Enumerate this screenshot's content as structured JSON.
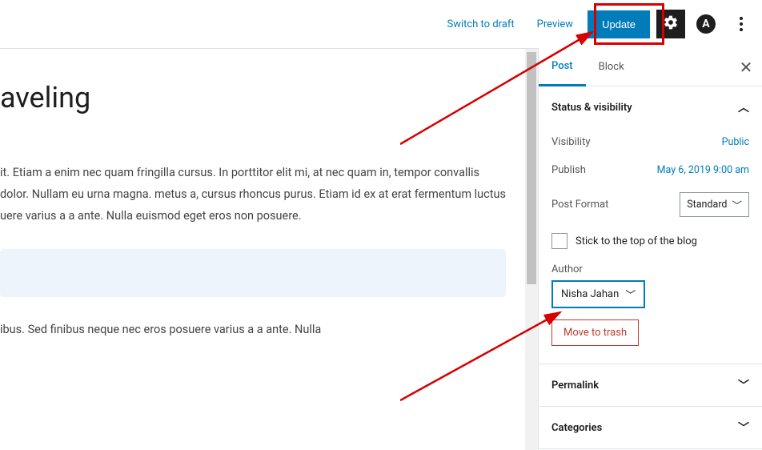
{
  "topbar": {
    "switch_draft": "Switch to draft",
    "preview": "Preview",
    "update": "Update"
  },
  "icons": {
    "settings": "gear",
    "brand_letter": "A"
  },
  "editor": {
    "title": "aveling",
    "para1": "it. Etiam a enim nec quam fringilla cursus. In porttitor elit mi, at nec quam in, tempor convallis dolor. Nullam eu urna magna. metus a, cursus rhoncus purus.  Etiam id ex at erat fermentum luctus uere varius a a ante. Nulla euismod eget eros non posuere.",
    "para2": "ibus. Sed finibus neque nec eros posuere varius a a ante. Nulla"
  },
  "sidebar": {
    "tabs": {
      "post": "Post",
      "block": "Block"
    },
    "panels": {
      "status": {
        "title": "Status & visibility",
        "visibility_label": "Visibility",
        "visibility_value": "Public",
        "publish_label": "Publish",
        "publish_value": "May 6, 2019 9:00 am",
        "format_label": "Post Format",
        "format_value": "Standard",
        "stick_label": "Stick to the top of the blog",
        "author_label": "Author",
        "author_value": "Nisha Jahan",
        "trash": "Move to trash"
      },
      "permalink": {
        "title": "Permalink"
      },
      "categories": {
        "title": "Categories"
      }
    }
  }
}
